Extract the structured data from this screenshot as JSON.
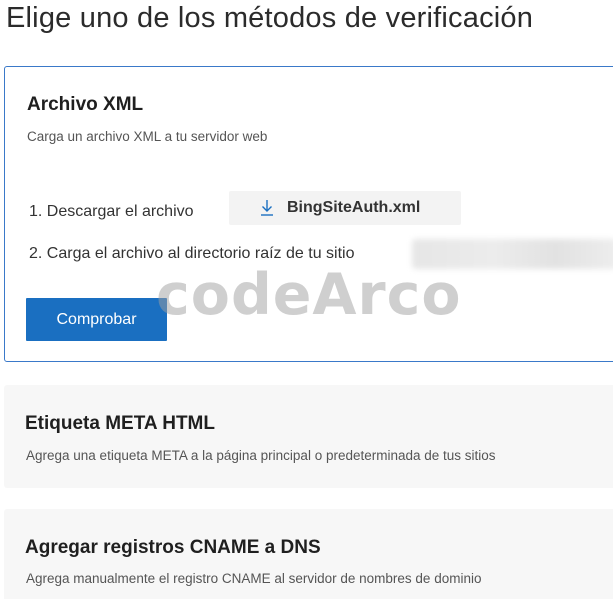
{
  "page": {
    "title": "Elige uno de los métodos de verificación"
  },
  "xml_method": {
    "title": "Archivo XML",
    "description": "Carga un archivo XML a tu servidor web",
    "step1": "1. Descargar el archivo",
    "download_filename": "BingSiteAuth.xml",
    "step2": "2. Carga el archivo al directorio raíz de tu sitio",
    "verify_button": "Comprobar"
  },
  "meta_method": {
    "title": "Etiqueta META HTML",
    "description": "Agrega una etiqueta META a la página principal o predeterminada de tus sitios"
  },
  "cname_method": {
    "title": "Agregar registros CNAME a DNS",
    "description": "Agrega manualmente el registro CNAME al servidor de nombres de dominio"
  },
  "watermark": {
    "text": "codeArco"
  },
  "colors": {
    "accent": "#1a6fc1",
    "selected_border": "#3a79c9",
    "card_background": "#f7f7f7"
  },
  "icons": {
    "download": "download-icon"
  }
}
